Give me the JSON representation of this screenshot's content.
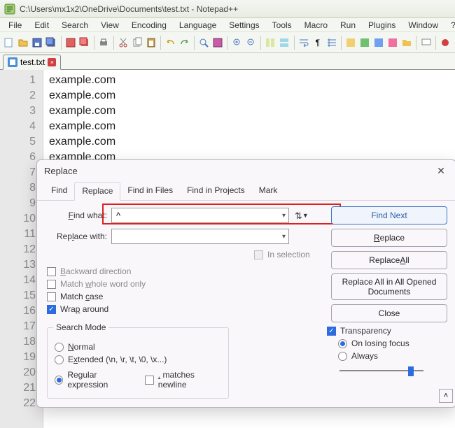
{
  "window": {
    "title": "C:\\Users\\mx1x2\\OneDrive\\Documents\\test.txt - Notepad++"
  },
  "menu": [
    "File",
    "Edit",
    "Search",
    "View",
    "Encoding",
    "Language",
    "Settings",
    "Tools",
    "Macro",
    "Run",
    "Plugins",
    "Window",
    "?"
  ],
  "tab": {
    "name": "test.txt"
  },
  "editor": {
    "lines": [
      "example.com",
      "example.com",
      "example.com",
      "example.com",
      "example.com",
      "example.com"
    ],
    "line_count": 22
  },
  "dialog": {
    "title": "Replace",
    "tabs": [
      "Find",
      "Replace",
      "Find in Files",
      "Find in Projects",
      "Mark"
    ],
    "active_tab": "Replace",
    "find_label": "Find what:",
    "find_value": "^",
    "replace_label": "Replace with:",
    "replace_value": "",
    "in_selection": "In selection",
    "backward": "Backward direction",
    "whole_word": "Match whole word only",
    "match_case": "Match case",
    "wrap": "Wrap around",
    "search_mode_legend": "Search Mode",
    "mode_normal": "Normal",
    "mode_extended": "Extended (\\n, \\r, \\t, \\0, \\x...)",
    "mode_regex": "Regular expression",
    "matches_newline": ". matches newline",
    "transparency": "Transparency",
    "on_losing_focus": "On losing focus",
    "always": "Always",
    "btn_find_next": "Find Next",
    "btn_replace": "Replace",
    "btn_replace_all": "Replace All",
    "btn_replace_all_docs": "Replace All in All Opened Documents",
    "btn_close": "Close",
    "corner": "˄"
  }
}
